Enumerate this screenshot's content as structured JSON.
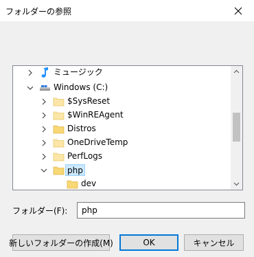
{
  "window": {
    "title": "フォルダーの参照"
  },
  "tree": {
    "items": [
      {
        "label": "ミュージック",
        "icon": "music-note-icon",
        "expander": "collapsed"
      },
      {
        "label": "Windows (C:)",
        "icon": "drive-icon",
        "expander": "expanded"
      },
      {
        "label": "$SysReset",
        "icon": "folder-icon",
        "expander": "collapsed"
      },
      {
        "label": "$WinREAgent",
        "icon": "folder-icon",
        "expander": "collapsed"
      },
      {
        "label": "Distros",
        "icon": "folder-icon",
        "expander": "collapsed"
      },
      {
        "label": "OneDriveTemp",
        "icon": "folder-icon",
        "expander": "collapsed"
      },
      {
        "label": "PerfLogs",
        "icon": "folder-icon",
        "expander": "collapsed"
      },
      {
        "label": "php",
        "icon": "folder-icon",
        "expander": "expanded",
        "selected": true
      },
      {
        "label": "dev",
        "icon": "folder-icon",
        "expander": "none"
      }
    ]
  },
  "folder": {
    "label": "フォルダー(F):",
    "value": "php"
  },
  "buttons": {
    "new_folder": "新しいフォルダーの作成(M)",
    "ok": "OK",
    "cancel": "キャンセル"
  },
  "colors": {
    "accent": "#0078d7",
    "selection_bg": "#cce8ff",
    "selection_border": "#99d1ff",
    "folder_yellow": "#f8d775",
    "music_blue": "#1e90ff"
  }
}
